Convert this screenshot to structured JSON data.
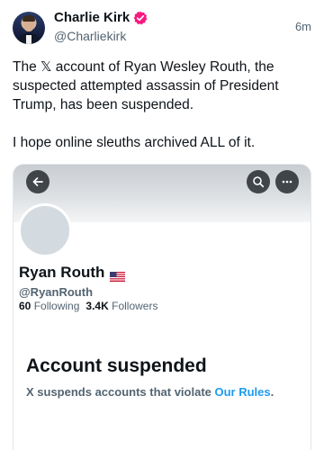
{
  "post": {
    "author_name": "Charlie Kirk",
    "author_handle": "@Charliekirk",
    "timestamp": "6m",
    "text_line_1": "The 𝕏 account of Ryan Wesley Routh, the suspected attempted assassin of President Trump, has been suspended.",
    "text_line_2": "I hope online sleuths archived ALL of it.",
    "verified_color": "#f91880"
  },
  "card": {
    "profile_name": "Ryan Routh",
    "profile_flag": "us-flag-icon",
    "profile_handle": "@RyanRouth",
    "following_count": "60",
    "following_label": "Following",
    "followers_count": "3.4K",
    "followers_label": "Followers",
    "suspended_title": "Account suspended",
    "suspended_desc_prefix": "X suspends accounts that violate ",
    "suspended_link": "Our Rules",
    "suspended_desc_suffix": ".",
    "link_color": "#1d9bf0"
  }
}
